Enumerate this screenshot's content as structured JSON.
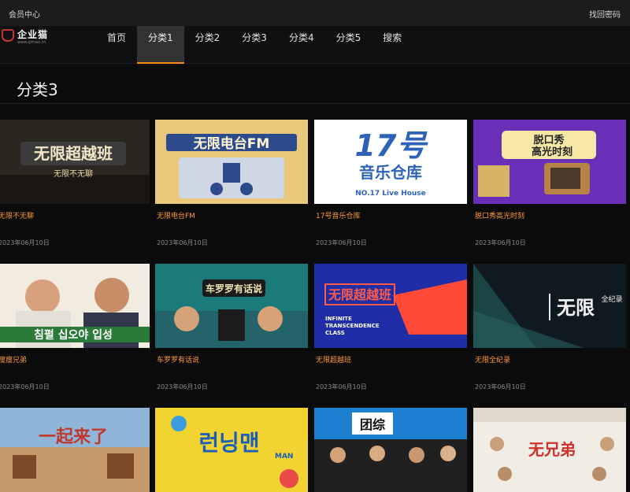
{
  "topbar": {
    "member_center": "会员中心",
    "find_password": "找回密码"
  },
  "logo": {
    "name": "企业猫",
    "sub": "www.qimao.cn"
  },
  "nav": {
    "items": [
      "首页",
      "分类1",
      "分类2",
      "分类3",
      "分类4",
      "分类5",
      "搜索"
    ],
    "active_index": 1
  },
  "section": {
    "title": "分类3"
  },
  "colors": {
    "accent": "#ff8c1a",
    "title_orange": "#ff9a3c",
    "background": "#0b0b0b"
  },
  "cards": [
    {
      "title": "无限不无聊",
      "date": "2023年06月10日",
      "thumb_text": "无限超越班",
      "thumb_sub": "无限不无聊",
      "scheme": "dark"
    },
    {
      "title": "无限电台FM",
      "date": "2023年06月10日",
      "thumb_text": "无限电台FM",
      "thumb_sub": "",
      "scheme": "radio"
    },
    {
      "title": "17号音乐仓库",
      "date": "2023年06月10日",
      "thumb_text": "17号",
      "thumb_sub": "音乐仓库",
      "thumb_sub2": "NO.17 Live House",
      "scheme": "music"
    },
    {
      "title": "脱口秀高光时刻",
      "date": "2023年06月10日",
      "thumb_text": "脱口秀",
      "thumb_sub": "高光时刻",
      "scheme": "talk"
    },
    {
      "title": "瘦瘦兄弟",
      "date": "2023年06月10日",
      "thumb_text": "침펄 십오야 입성",
      "thumb_sub": "",
      "scheme": "korean"
    },
    {
      "title": "车罗罗有话说",
      "date": "2023年06月10日",
      "thumb_text": "车罗罗有话说",
      "thumb_sub": "",
      "scheme": "car"
    },
    {
      "title": "无限超越班",
      "date": "2023年06月10日",
      "thumb_text": "无限超越班",
      "thumb_sub": "INFINITE TRANSCENDENCE CLASS",
      "scheme": "infinite"
    },
    {
      "title": "无限全纪录",
      "date": "2023年06月10日",
      "thumb_text": "无限",
      "thumb_sub": "全纪录",
      "scheme": "record"
    },
    {
      "title": "",
      "date": "",
      "thumb_text": "一起来了",
      "thumb_sub": "",
      "scheme": "village"
    },
    {
      "title": "",
      "date": "",
      "thumb_text": "런닝맨",
      "thumb_sub": "",
      "scheme": "running"
    },
    {
      "title": "",
      "date": "",
      "thumb_text": "团综",
      "thumb_sub": "",
      "scheme": "group"
    },
    {
      "title": "",
      "date": "",
      "thumb_text": "无兄弟",
      "thumb_sub": "",
      "scheme": "brothers"
    }
  ]
}
